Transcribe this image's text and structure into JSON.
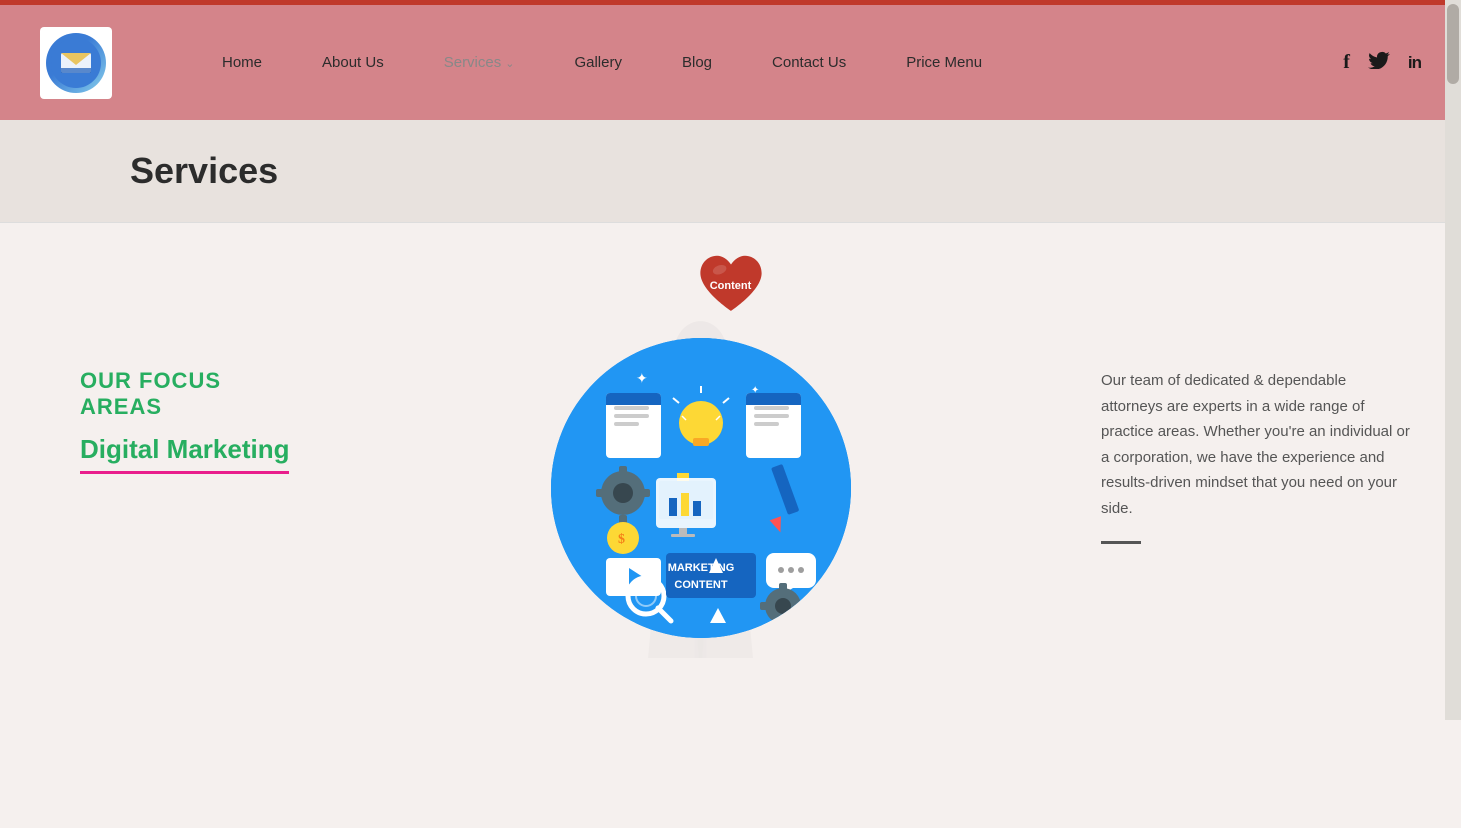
{
  "topbar": {
    "color": "#c0392b"
  },
  "header": {
    "background": "#d4848a",
    "logo_alt": "Company Logo"
  },
  "nav": {
    "items": [
      {
        "label": "Home",
        "active": false
      },
      {
        "label": "About Us",
        "active": false
      },
      {
        "label": "Services",
        "active": true,
        "has_dropdown": true
      },
      {
        "label": "Gallery",
        "active": false
      },
      {
        "label": "Blog",
        "active": false
      },
      {
        "label": "Contact Us",
        "active": false
      },
      {
        "label": "Price Menu",
        "active": false
      }
    ]
  },
  "social": {
    "facebook": "f",
    "twitter": "t",
    "linkedin": "in"
  },
  "page_title": "Services",
  "heart_badge": {
    "label": "Content"
  },
  "focus_areas": {
    "title": "OUR FOCUS AREAS",
    "subtitle": "Digital Marketing"
  },
  "marketing_circle": {
    "line1": "MARKETING",
    "line2": "CONTENT"
  },
  "right_text": {
    "paragraph": "Our team of dedicated & dependable attorneys are experts in a wide range of practice areas. Whether you're an individual or a corporation, we have the experience and results-driven mindset that you need on your side."
  }
}
